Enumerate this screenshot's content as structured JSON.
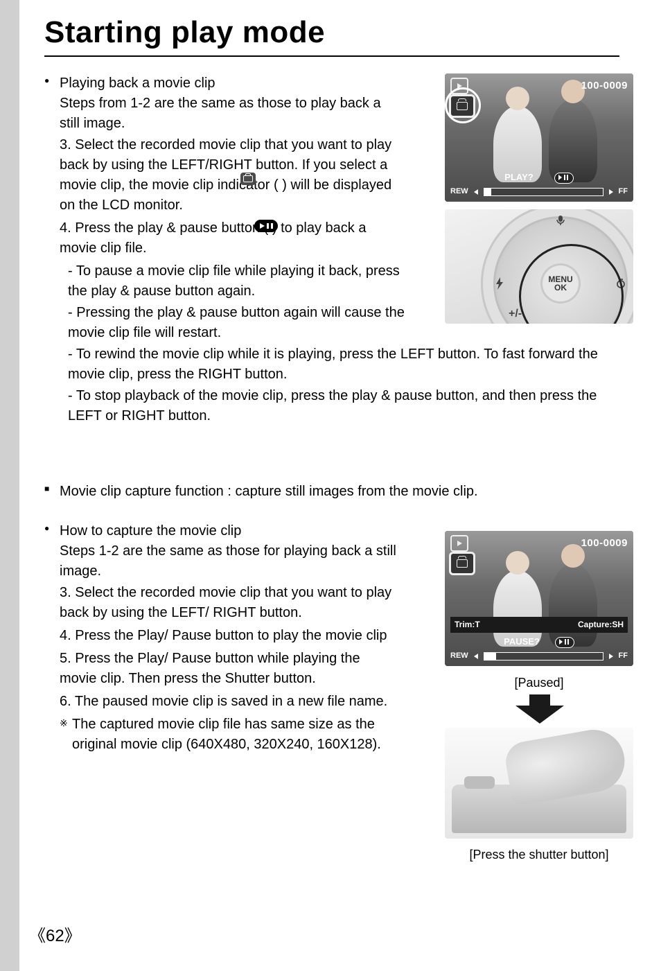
{
  "title": "Starting play mode",
  "sec1": {
    "heading": "Playing back a movie clip",
    "lead": "Steps from 1-2 are the same as those to play back a still image.",
    "step3": "3. Select the recorded movie clip that you want to play back by using the LEFT/RIGHT button. If you select a movie clip, the movie clip indicator (        ) will be displayed on the LCD monitor.",
    "step4": "4. Press the play & pause button (            ) to play back a movie clip file.",
    "subs": [
      "- To pause a movie clip file while playing it back, press the play & pause button again.",
      "- Pressing the play & pause button again will cause the movie clip file will restart.",
      "- To rewind the movie clip while it is playing, press the LEFT button. To fast forward the movie clip, press the RIGHT button.",
      "- To stop playback of the movie clip, press the play & pause button, and then press the LEFT or RIGHT button."
    ]
  },
  "sec_note": "Movie clip capture function : capture still images from the movie clip.",
  "sec2": {
    "heading": "How to capture the movie clip",
    "lead": "Steps 1-2 are the same as those for playing back a still image.",
    "steps": [
      "3. Select the recorded movie clip that you want to play back by using the LEFT/ RIGHT button.",
      "4. Press the Play/ Pause button to play the movie clip",
      "5. Press the Play/ Pause button while playing the movie clip. Then press the Shutter button.",
      "6. The paused movie clip is saved in a new file name."
    ],
    "note_mark": "※",
    "note": "The captured movie clip file has same size as the original movie clip (640X480, 320X240, 160X128)."
  },
  "osd": {
    "filecount": "100-0009",
    "play": "PLAY?",
    "pause": "PAUSE?",
    "rew": "REW",
    "ff": "FF",
    "trim": "Trim:T",
    "capture": "Capture:SH",
    "menu_top": "MENU",
    "menu_bot": "OK"
  },
  "captions": {
    "paused": "[Paused]",
    "shutter": "[Press the shutter button]"
  },
  "page_number": "62"
}
